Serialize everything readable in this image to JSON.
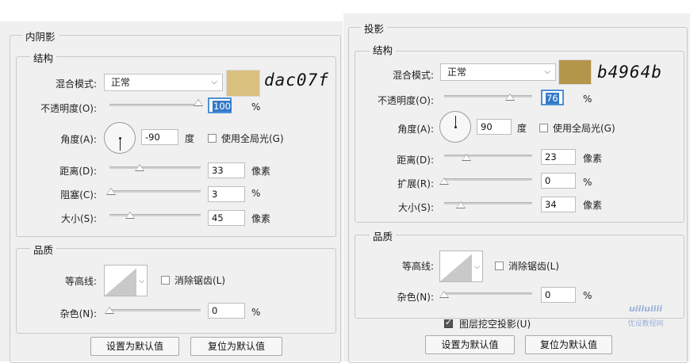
{
  "left": {
    "title": "内阴影",
    "structure": {
      "title": "结构",
      "blend_label": "混合模式:",
      "blend_value": "正常",
      "color": "#dac07f",
      "hex_text": "dac07f",
      "opacity_label": "不透明度(O):",
      "opacity_value": "100",
      "opacity_pct": 100,
      "percent": "%",
      "angle_label": "角度(A):",
      "angle_value": "-90",
      "degree": "度",
      "global_light": "使用全局光(G)",
      "distance_label": "距离(D):",
      "distance_value": "33",
      "choke_label": "阻塞(C):",
      "choke_value": "3",
      "size_label": "大小(S):",
      "size_value": "45",
      "px": "像素"
    },
    "quality": {
      "title": "品质",
      "contour_label": "等高线:",
      "anti_alias": "消除锯齿(L)",
      "noise_label": "杂色(N):",
      "noise_value": "0",
      "percent": "%"
    },
    "buttons": {
      "set_default": "设置为默认值",
      "reset_default": "复位为默认值"
    }
  },
  "right": {
    "title": "投影",
    "structure": {
      "title": "结构",
      "blend_label": "混合模式:",
      "blend_value": "正常",
      "color": "#b4964b",
      "hex_text": "b4964b",
      "opacity_label": "不透明度(O):",
      "opacity_value": "76",
      "opacity_pct": 76,
      "percent": "%",
      "angle_label": "角度(A):",
      "angle_value": "90",
      "degree": "度",
      "global_light": "使用全局光(G)",
      "distance_label": "距离(D):",
      "distance_value": "23",
      "spread_label": "扩展(R):",
      "spread_value": "0",
      "size_label": "大小(S):",
      "size_value": "34",
      "px": "像素"
    },
    "quality": {
      "title": "品质",
      "contour_label": "等高线:",
      "anti_alias": "消除锯齿(L)",
      "noise_label": "杂色(N):",
      "noise_value": "0",
      "percent": "%",
      "knockout": "图层挖空投影(U)"
    },
    "buttons": {
      "set_default": "设置为默认值",
      "reset_default": "复位为默认值"
    }
  },
  "watermark": {
    "logo": "uiiiuiiii",
    "text": "优设教程网"
  }
}
